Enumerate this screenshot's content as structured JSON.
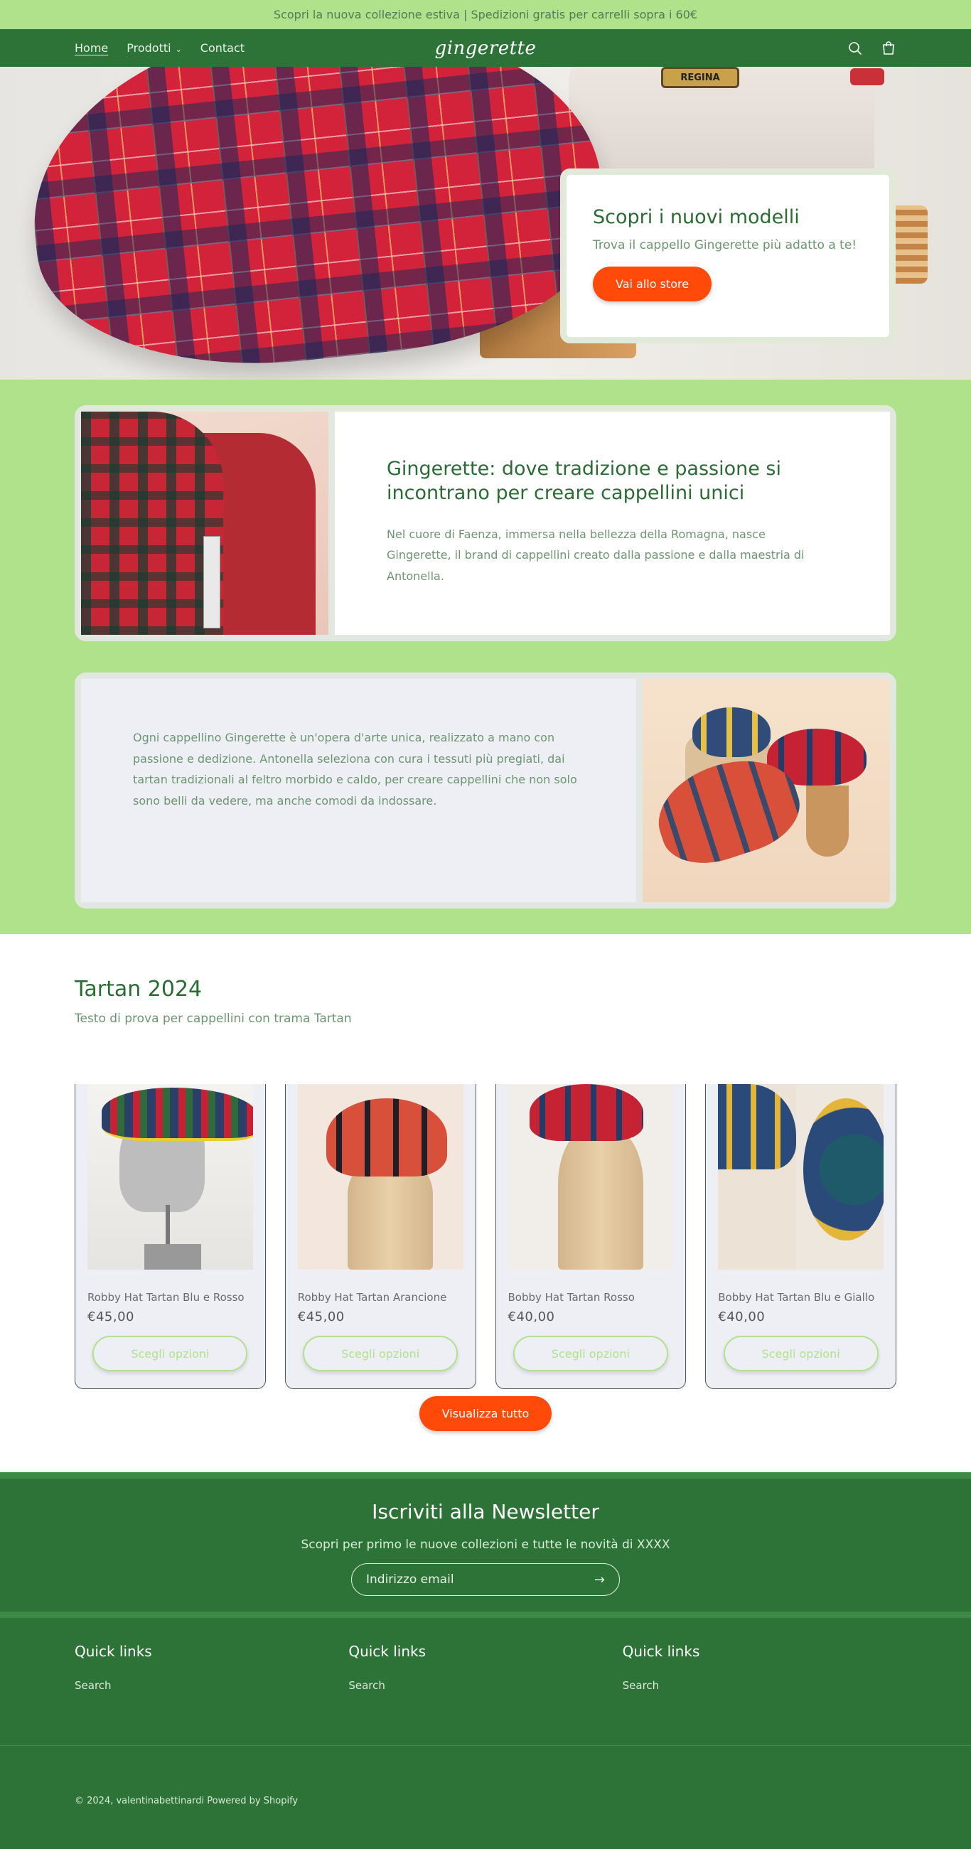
{
  "announcement": "Scopri la nuova collezione estiva | Spedizioni gratis per carrelli sopra i 60€",
  "header": {
    "logo": "gingerette",
    "nav": [
      {
        "label": "Home"
      },
      {
        "label": "Prodotti"
      },
      {
        "label": "Contact"
      }
    ],
    "icons": [
      "search-icon",
      "cart-icon"
    ]
  },
  "hero": {
    "machine_plate": "REGINA",
    "title": "Scopri i nuovi modelli",
    "text": "Trova il cappello Gingerette più adatto a te!",
    "button": "Vai allo store"
  },
  "story1": {
    "title": "Gingerette: dove tradizione e passione si incontrano per creare cappellini unici",
    "text": "Nel cuore di Faenza, immersa nella bellezza della Romagna, nasce Gingerette, il brand di cappellini creato dalla passione e dalla maestria di Antonella."
  },
  "story2": {
    "text": "Ogni cappellino Gingerette è un'opera d'arte unica, realizzato a mano con passione e dedizione. Antonella seleziona con cura i tessuti più pregiati, dai tartan tradizionali al feltro morbido e caldo, per creare cappellini che non solo sono belli da vedere, ma anche comodi da indossare."
  },
  "collection": {
    "title": "Tartan 2024",
    "subtitle": "Testo di prova per cappellini con trama Tartan",
    "products": [
      {
        "name": "Robby Hat Tartan Blu e Rosso",
        "price": "€45,00",
        "button": "Scegli opzioni"
      },
      {
        "name": "Robby Hat Tartan Arancione",
        "price": "€45,00",
        "button": "Scegli opzioni"
      },
      {
        "name": "Bobby Hat Tartan Rosso",
        "price": "€40,00",
        "button": "Scegli opzioni"
      },
      {
        "name": "Bobby Hat Tartan Blu e Giallo",
        "price": "€40,00",
        "button": "Scegli opzioni"
      }
    ],
    "view_all": "Visualizza tutto"
  },
  "newsletter": {
    "title": "Iscriviti alla Newsletter",
    "text": "Scopri per primo le nuove collezioni e tutte le novità di XXXX",
    "placeholder": "Indirizzo email"
  },
  "footer": {
    "columns": [
      {
        "title": "Quick links",
        "link": "Search"
      },
      {
        "title": "Quick links",
        "link": "Search"
      },
      {
        "title": "Quick links",
        "link": "Search"
      }
    ],
    "copyright": "© 2024, valentinabettinardi Powered by Shopify"
  },
  "colors": {
    "accent_green": "#2d7337",
    "light_green": "#b0e28c",
    "cta_orange": "#ff4a0a"
  }
}
